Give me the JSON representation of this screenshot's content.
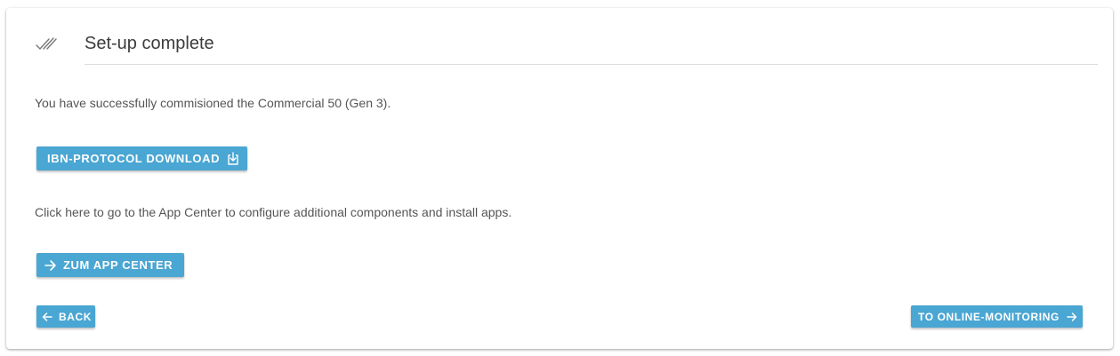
{
  "header": {
    "title": "Set-up complete",
    "icon": "double-check-icon"
  },
  "messages": {
    "success": "You have successfully commisioned the Commercial 50 (Gen 3).",
    "app_center_hint": "Click here to go to the App Center to configure additional components and install apps."
  },
  "buttons": {
    "download": {
      "label": "IBN-PROTOCOL DOWNLOAD",
      "icon": "download-icon"
    },
    "app_center": {
      "label": "ZUM APP CENTER",
      "icon": "arrow-right-icon"
    },
    "back": {
      "label": "BACK",
      "icon": "arrow-left-icon"
    },
    "online_monitoring": {
      "label": "TO ONLINE-MONITORING",
      "icon": "arrow-right-icon"
    }
  },
  "colors": {
    "button_bg": "#4aa6d3",
    "button_text": "#ffffff",
    "title_text": "#3c3c3c",
    "body_text": "#555555",
    "divider": "#dcdcdc"
  }
}
